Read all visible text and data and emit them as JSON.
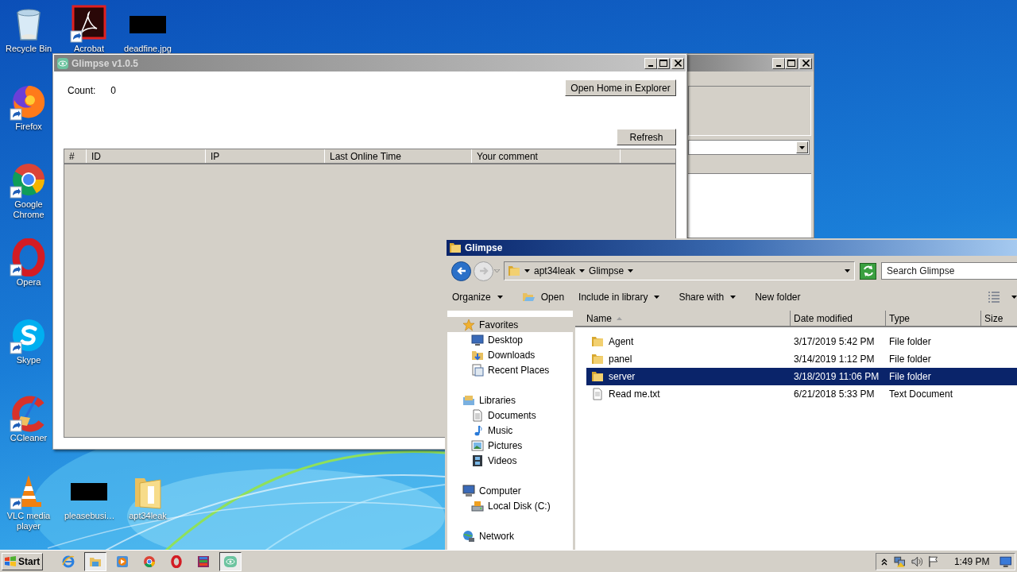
{
  "desktop_icons": [
    {
      "label": "Recycle Bin",
      "kind": "recycle",
      "shortcut": false
    },
    {
      "label": "Acrobat",
      "kind": "acrobat",
      "shortcut": true
    },
    {
      "label": "deadfine.jpg",
      "kind": "black-image",
      "shortcut": false
    },
    {
      "label": "Firefox",
      "kind": "firefox",
      "shortcut": true
    },
    {
      "label": "Google Chrome",
      "kind": "chrome",
      "shortcut": true
    },
    {
      "label": "Opera",
      "kind": "opera",
      "shortcut": true
    },
    {
      "label": "Skype",
      "kind": "skype",
      "shortcut": true
    },
    {
      "label": "CCleaner",
      "kind": "ccleaner",
      "shortcut": true
    },
    {
      "label": "VLC media player",
      "kind": "vlc",
      "shortcut": true
    },
    {
      "label": "pleasebusi…",
      "kind": "black-image",
      "shortcut": false
    },
    {
      "label": "apt34leak",
      "kind": "folder",
      "shortcut": false
    }
  ],
  "glimpse_window": {
    "title": "Glimpse v1.0.5",
    "count_label": "Count:",
    "count_value": "0",
    "open_button": "Open Home in Explorer",
    "refresh_button": "Refresh",
    "columns": [
      "#",
      "ID",
      "IP",
      "Last Online Time",
      "Your comment"
    ]
  },
  "explorer": {
    "title": "Glimpse",
    "breadcrumb": [
      "apt34leak",
      "Glimpse"
    ],
    "search": {
      "placeholder": "Search Glimpse"
    },
    "toolbar": [
      {
        "label": "Organize",
        "kind": "menu"
      },
      {
        "label": "Open",
        "kind": "open"
      },
      {
        "label": "Include in library",
        "kind": "menu"
      },
      {
        "label": "Share with",
        "kind": "menu"
      },
      {
        "label": "New folder",
        "kind": "plain"
      }
    ],
    "navigation": [
      {
        "label": "Favorites",
        "kind": "star",
        "selected": true,
        "children": [
          {
            "label": "Desktop",
            "kind": "desktop",
            "selected": false
          },
          {
            "label": "Downloads",
            "kind": "downloads",
            "selected": false
          },
          {
            "label": "Recent Places",
            "kind": "recent",
            "selected": false
          }
        ]
      },
      {
        "label": "Libraries",
        "kind": "libraries",
        "selected": false,
        "children": [
          {
            "label": "Documents",
            "kind": "documents",
            "selected": false
          },
          {
            "label": "Music",
            "kind": "music",
            "selected": false
          },
          {
            "label": "Pictures",
            "kind": "pictures",
            "selected": false
          },
          {
            "label": "Videos",
            "kind": "videos",
            "selected": false
          }
        ]
      },
      {
        "label": "Computer",
        "kind": "computer",
        "selected": false,
        "children": [
          {
            "label": "Local Disk (C:)",
            "kind": "disk",
            "selected": false
          }
        ]
      },
      {
        "label": "Network",
        "kind": "network",
        "selected": false
      }
    ],
    "columns": [
      {
        "label": "Name",
        "sorted": true
      },
      {
        "label": "Date modified",
        "sorted": false
      },
      {
        "label": "Type",
        "sorted": false
      },
      {
        "label": "Size",
        "sorted": false
      }
    ],
    "files": [
      {
        "name": "Agent",
        "date": "3/17/2019 5:42 PM",
        "type": "File folder",
        "kind": "folder",
        "selected": false
      },
      {
        "name": "panel",
        "date": "3/14/2019 1:12 PM",
        "type": "File folder",
        "kind": "folder",
        "selected": false
      },
      {
        "name": "server",
        "date": "3/18/2019 11:06 PM",
        "type": "File folder",
        "kind": "folder",
        "selected": true
      },
      {
        "name": "Read me.txt",
        "date": "6/21/2018 5:33 PM",
        "type": "Text Document",
        "kind": "text",
        "selected": false
      }
    ]
  },
  "taskbar": {
    "start": "Start",
    "apps": [
      {
        "kind": "ie",
        "pressed": false
      },
      {
        "kind": "explorer",
        "pressed": true
      },
      {
        "kind": "media",
        "pressed": false
      },
      {
        "kind": "chrome",
        "pressed": false
      },
      {
        "kind": "opera",
        "pressed": false
      },
      {
        "kind": "archive",
        "pressed": false
      },
      {
        "kind": "glimpse",
        "pressed": true
      }
    ],
    "clock": "1:49 PM"
  }
}
